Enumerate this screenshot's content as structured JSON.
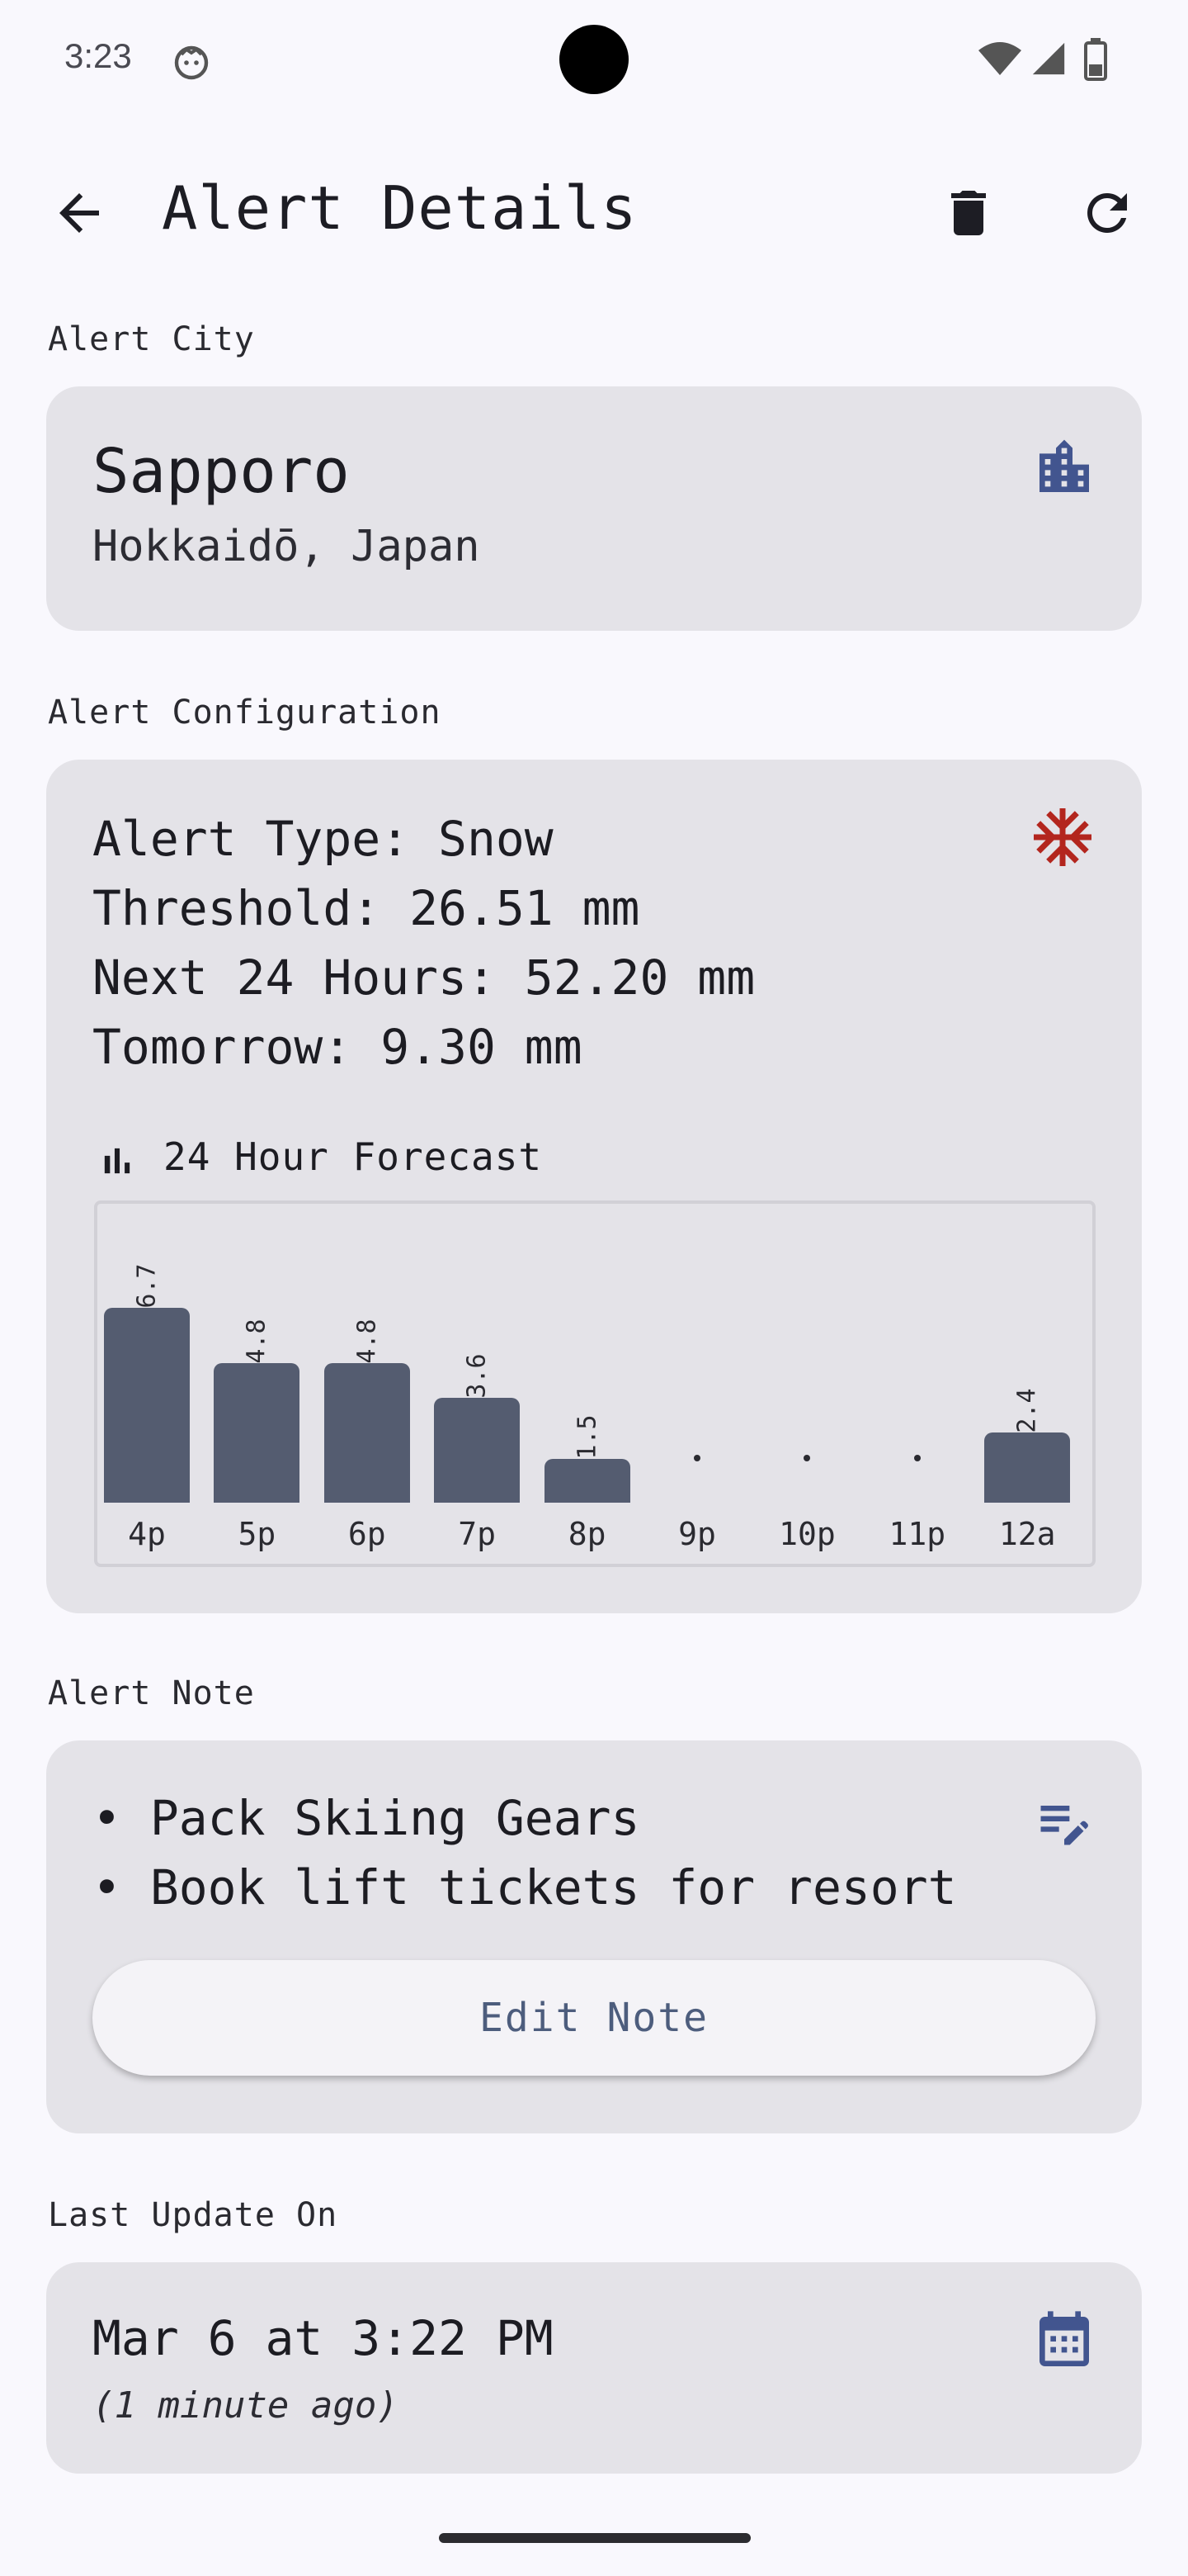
{
  "status_bar": {
    "time": "3:23"
  },
  "header": {
    "title": "Alert Details"
  },
  "city_section": {
    "label": "Alert City",
    "city": "Sapporo",
    "region": "Hokkaidō, Japan"
  },
  "config_section": {
    "label": "Alert Configuration",
    "lines": [
      "Alert Type: Snow",
      "Threshold: 26.51 mm",
      "Next 24 Hours: 52.20 mm",
      "Tomorrow: 9.30 mm"
    ],
    "forecast_title": "24 Hour Forecast"
  },
  "chart_data": {
    "type": "bar",
    "categories": [
      "4p",
      "5p",
      "6p",
      "7p",
      "8p",
      "9p",
      "10p",
      "11p",
      "12a"
    ],
    "values": [
      6.7,
      4.8,
      4.8,
      3.6,
      1.5,
      0,
      0,
      0,
      2.4
    ],
    "value_labels": [
      "6.7",
      "4.8",
      "4.8",
      "3.6",
      "1.5",
      ".",
      ".",
      ".",
      "2.4"
    ],
    "colors": {
      "bar": "#545c70"
    }
  },
  "note_section": {
    "label": "Alert Note",
    "items": [
      "• Pack Skiing Gears",
      "• Book lift tickets for resort"
    ],
    "edit_button": "Edit Note"
  },
  "update_section": {
    "label": "Last Update On",
    "datetime": "Mar 6 at 3:22 PM",
    "relative": "(1 minute ago)"
  },
  "colors": {
    "accent_blue": "#42558f",
    "snow_red": "#b3261e",
    "card_bg": "#e4e3e8",
    "page_bg": "#f9f8fd"
  }
}
